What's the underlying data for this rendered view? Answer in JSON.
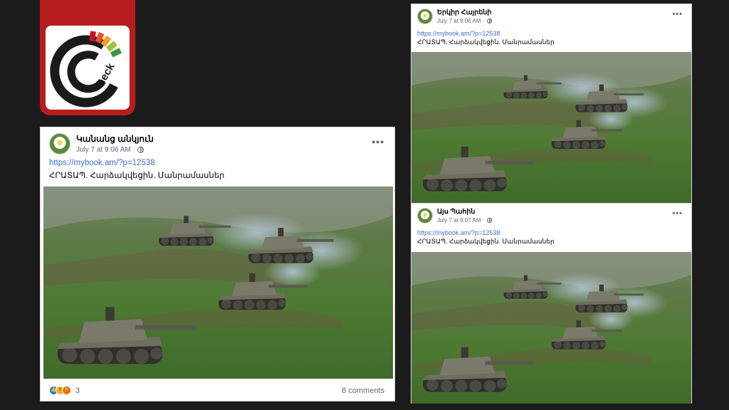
{
  "logo": {
    "text": "heck",
    "brand_color": "#b71d1d"
  },
  "posts": [
    {
      "author": "Կանանց անկյուն",
      "time": "July 7 at 9:06 AM",
      "privacy_icon": "globe-icon",
      "link": "https://mybook.am/?p=12538",
      "text": "ՀՐԱՏԱՊ. Հարձակվեցին. Մանրամասներ",
      "reactions": {
        "icons": [
          "like",
          "wow",
          "angry"
        ],
        "count": "3"
      },
      "comments": "8 comments"
    },
    {
      "author": "Երկիր Հայրենի",
      "time": "July 7 at 9:06 AM",
      "privacy_icon": "globe-icon",
      "link": "https://mybook.am/?p=12538",
      "text": "ՀՐԱՏԱՊ. Հարձակվեցին. Մանրամասներ"
    },
    {
      "author": "Այս Պահին",
      "time": "July 7 at 9:07 AM",
      "privacy_icon": "globe-icon",
      "link": "https://mybook.am/?p=12538",
      "text": "ՀՐԱՏԱՊ. Հարձակվեցին. Մանրամասներ"
    }
  ],
  "colors": {
    "background": "#1c1b1c",
    "link": "#3a6fc9",
    "like": "#1877f2"
  }
}
